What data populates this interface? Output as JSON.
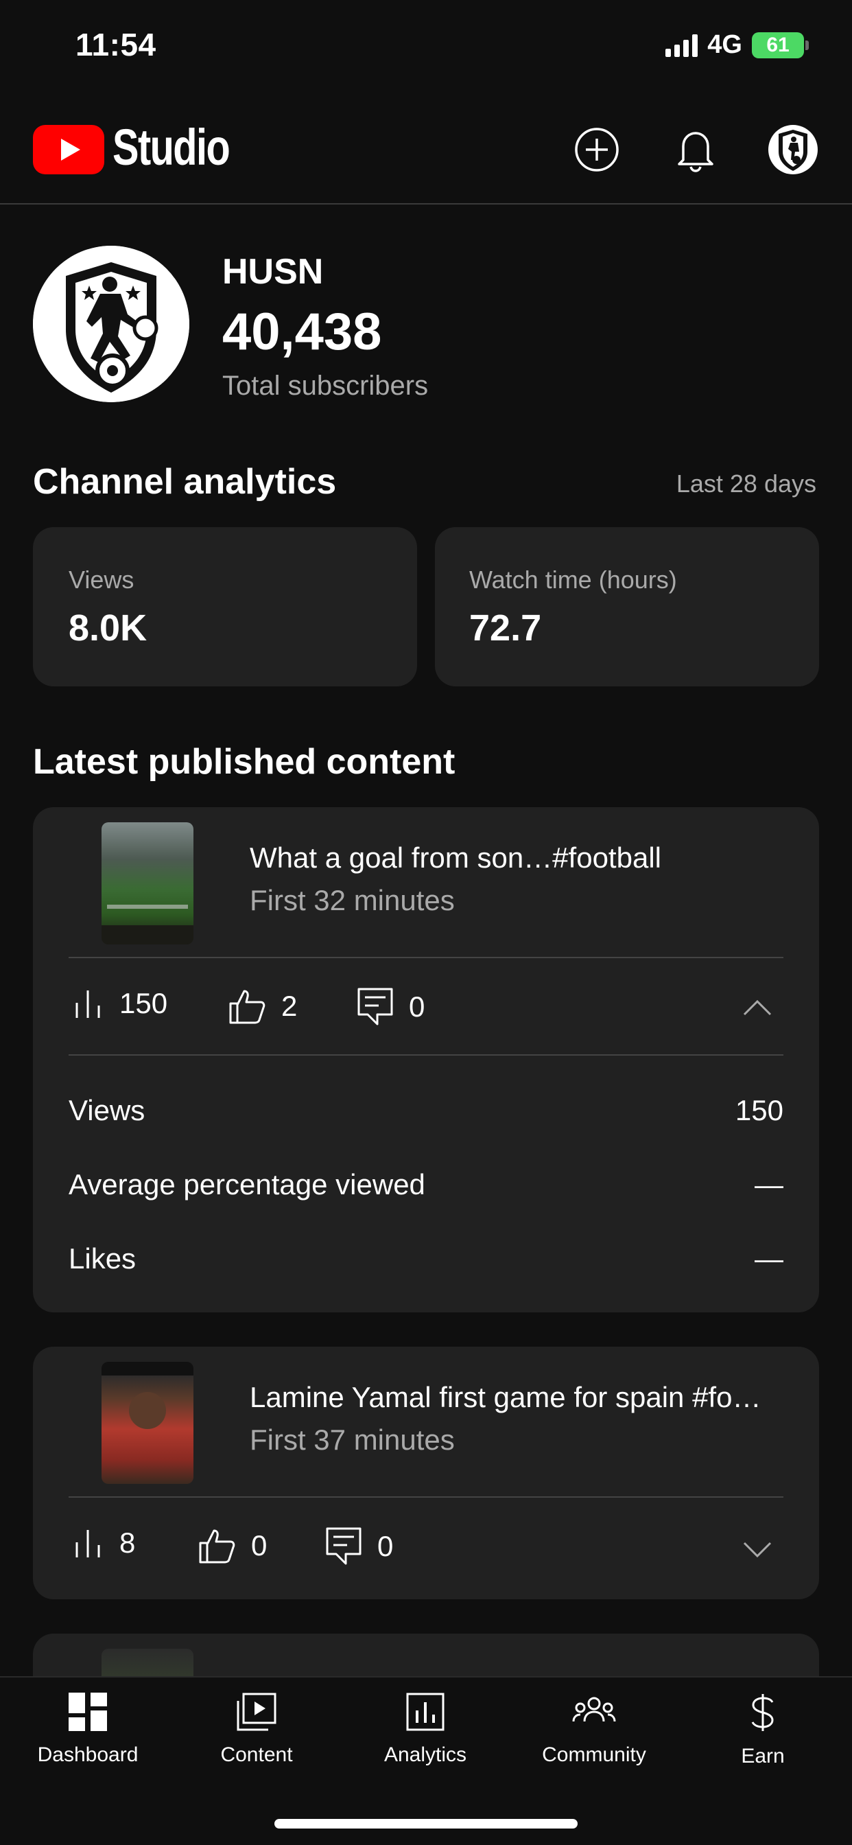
{
  "status": {
    "time": "11:54",
    "network": "4G",
    "battery": "61"
  },
  "header": {
    "app_name": "Studio"
  },
  "channel": {
    "name": "HUSN",
    "subscribers": "40,438",
    "subscribers_label": "Total subscribers"
  },
  "analytics": {
    "title": "Channel analytics",
    "range": "Last 28 days",
    "cards": [
      {
        "label": "Views",
        "value": "8.0K"
      },
      {
        "label": "Watch time (hours)",
        "value": "72.7"
      }
    ]
  },
  "latest": {
    "title": "Latest published content",
    "items": [
      {
        "title": "What a goal from son…#football",
        "subtitle": "First 32 minutes",
        "views": "150",
        "likes": "2",
        "comments": "0",
        "details": [
          {
            "label": "Views",
            "value": "150"
          },
          {
            "label": "Average percentage viewed",
            "value": "—"
          },
          {
            "label": "Likes",
            "value": "—"
          }
        ]
      },
      {
        "title": "Lamine Yamal first game for spain #fo…",
        "subtitle": "First 37 minutes",
        "views": "8",
        "likes": "0",
        "comments": "0"
      }
    ]
  },
  "nav": [
    {
      "label": "Dashboard",
      "icon": "dashboard-icon"
    },
    {
      "label": "Content",
      "icon": "content-icon"
    },
    {
      "label": "Analytics",
      "icon": "analytics-icon"
    },
    {
      "label": "Community",
      "icon": "community-icon"
    },
    {
      "label": "Earn",
      "icon": "earn-icon"
    }
  ],
  "colors": {
    "background": "#0f0f0f",
    "card": "#212121",
    "youtube_red": "#ff0000",
    "battery_green": "#4cd964",
    "secondary_text": "#aaaaaa"
  }
}
